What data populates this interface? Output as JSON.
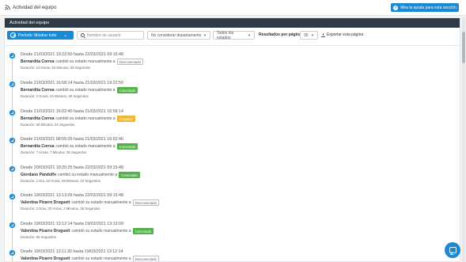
{
  "app": {
    "title": "Actividad del equipo",
    "help_label": "Mira la ayuda para esta sección"
  },
  "panel": {
    "header": "Actividad del equipo"
  },
  "filters": {
    "period_label": "Período: Mostrar todo",
    "search_placeholder": "Nombre de usuario",
    "department_value": "No considerar departamento",
    "state_value": "Todos los estados",
    "results_label": "Resultados por página",
    "results_per_page": "30",
    "export_label": "Exportar esta página"
  },
  "entries": [
    {
      "date": "Desde 21/03/2021 19:22:50 hasta 22/03/2021 09:15:48",
      "name": "Bernardita Correa",
      "action": "cambió su estado manualmente a",
      "status": "Desconectado",
      "status_type": "desconectado",
      "duration": "Duración: 13 Horas, 53 Minutos, 58 Segundos"
    },
    {
      "date": "Desde 21/03/2021 16:58:14 hasta 21/03/2021 19:22:50",
      "name": "Bernardita Correa",
      "action": "cambió su estado manualmente a",
      "status": "Conectado",
      "status_type": "conectado",
      "duration": "Duración: 2 Horas, 24 Minutos, 36 Segundos"
    },
    {
      "date": "Desde 21/03/2021 16:02:40 hasta 21/03/2021 16:58:14",
      "name": "Bernardita Correa",
      "action": "cambió su estado manualmente a",
      "status": "Ocupado",
      "status_type": "ocupado",
      "duration": "Duración: 55 Minutos, 34 Segundos"
    },
    {
      "date": "Desde 21/03/2021 08:55:05 hasta 21/03/2021 16:02:40",
      "name": "Bernardita Correa",
      "action": "cambió su estado manualmente a",
      "status": "Conectado",
      "status_type": "conectado",
      "duration": "Duración: 7 Horas, 7 Minutos, 35 Segundos"
    },
    {
      "date": "Desde 20/03/2021 10:20:25 hasta 22/03/2021 09:15:48",
      "name": "Giordano Pandolfo",
      "action": "cambió su estado manualmente a",
      "status": "Conectado",
      "status_type": "conectado",
      "duration": "Duración: 1 Día, 22 Horas, 55 Minutos, 23 Segundos"
    },
    {
      "date": "Desde 19/03/2021 13:13:09 hasta 22/03/2021 09:15:48",
      "name": "Valentina Pizarro Droguett",
      "action": "cambió su estado manualmente a",
      "status": "Desconectado",
      "status_type": "desconectado",
      "duration": "Duración: 2 Días, 20 Horas, 2 Minutos, 39 Segundos"
    },
    {
      "date": "Desde 19/03/2021 13:12:14 hasta 19/03/2021 13:13:09",
      "name": "Valentina Pizarro Droguett",
      "action": "cambió su estado manualmente a",
      "status": "Conectado",
      "status_type": "conectado",
      "duration": "Duración: 55 Segundos"
    },
    {
      "date": "Desde 19/03/2021 13:11:30 hasta 19/03/2021 13:12:14",
      "name": "Valentina Pizarro Droguett",
      "action": "cambió su estado manualmente a",
      "status": "Desconectado",
      "status_type": "desconectado",
      "duration": ""
    }
  ]
}
